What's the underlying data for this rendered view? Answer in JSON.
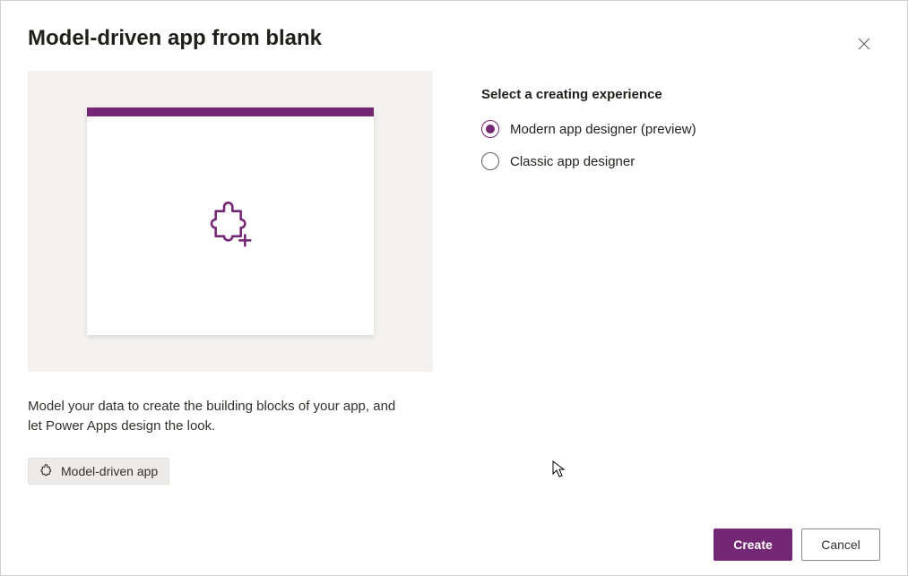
{
  "dialog": {
    "title": "Model-driven app from blank",
    "description": "Model your data to create the building blocks of your app, and let Power Apps design the look.",
    "tag": "Model-driven app"
  },
  "options": {
    "section_label": "Select a creating experience",
    "items": [
      {
        "label": "Modern app designer (preview)",
        "selected": true
      },
      {
        "label": "Classic app designer",
        "selected": false
      }
    ]
  },
  "footer": {
    "primary": "Create",
    "secondary": "Cancel"
  },
  "colors": {
    "accent": "#742774"
  }
}
